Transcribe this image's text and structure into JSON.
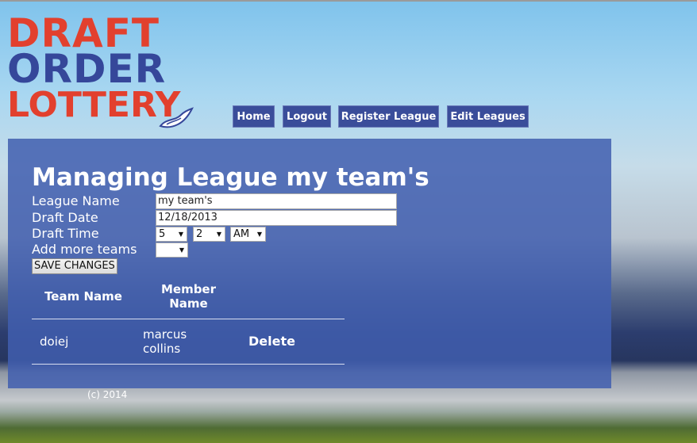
{
  "logo": {
    "line1": "DRAFT",
    "line2": "ORDER",
    "line3": "LOTTERY"
  },
  "nav": {
    "items": [
      {
        "label": "Home"
      },
      {
        "label": "Logout"
      },
      {
        "label": "Register League"
      },
      {
        "label": "Edit Leagues"
      }
    ]
  },
  "page": {
    "title": "Managing League my team's"
  },
  "form": {
    "league_name_label": "League Name",
    "league_name_value": "my team's",
    "draft_date_label": "Draft Date",
    "draft_date_value": "12/18/2013",
    "draft_time_label": "Draft Time",
    "draft_time_hour": "5",
    "draft_time_minute": "2",
    "draft_time_ampm": "AM",
    "add_teams_label": "Add more teams",
    "add_teams_value": "",
    "save_label": "SAVE CHANGES"
  },
  "table": {
    "headers": {
      "team": "Team Name",
      "member_line1": "Member",
      "member_line2": "Name"
    },
    "rows": [
      {
        "team": "doiej",
        "member_line1": "marcus",
        "member_line2": "collins",
        "action": "Delete"
      }
    ]
  },
  "footer": {
    "text": "(c) 2014"
  },
  "colors": {
    "logo_red": "#e2402e",
    "logo_blue": "#35479a",
    "nav_bg": "#3a4d9a",
    "panel_bg": "#415eaf"
  }
}
